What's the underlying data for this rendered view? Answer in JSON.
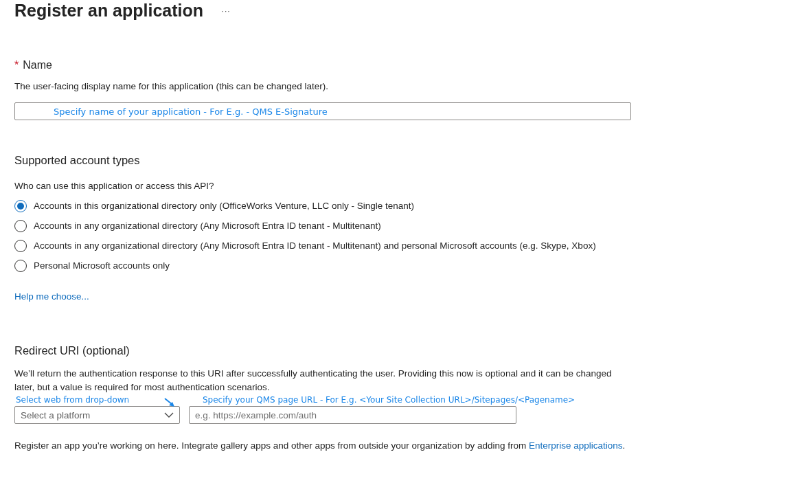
{
  "title": "Register an application",
  "more": "···",
  "name_section": {
    "required_mark": "*",
    "label": "Name",
    "description": "The user-facing display name for this application (this can be changed later).",
    "value": "Specify name of your application - For E.g. - QMS E-Signature"
  },
  "account_types": {
    "heading": "Supported account types",
    "question": "Who can use this application or access this API?",
    "options": [
      {
        "label": "Accounts in this organizational directory only (OfficeWorks Venture, LLC only - Single tenant)",
        "selected": true
      },
      {
        "label": "Accounts in any organizational directory (Any Microsoft Entra ID tenant - Multitenant)",
        "selected": false
      },
      {
        "label": "Accounts in any organizational directory (Any Microsoft Entra ID tenant - Multitenant) and personal Microsoft accounts (e.g. Skype, Xbox)",
        "selected": false
      },
      {
        "label": "Personal Microsoft accounts only",
        "selected": false
      }
    ],
    "help_link": "Help me choose..."
  },
  "redirect": {
    "heading": "Redirect URI (optional)",
    "description": "We’ll return the authentication response to this URI after successfully authenticating the user. Providing this now is optional and it can be changed later, but a value is required for most authentication scenarios.",
    "platform_note": "Select web from drop-down",
    "url_note": "Specify your QMS page URL - For E.g. <Your Site Collection URL>/Sitepages/<Pagename>",
    "platform_placeholder": "Select a platform",
    "url_placeholder": "e.g. https://example.com/auth"
  },
  "footer": {
    "text": "Register an app you’re working on here. Integrate gallery apps and other apps from outside your organization by adding from ",
    "link": "Enterprise applications",
    "end": "."
  }
}
